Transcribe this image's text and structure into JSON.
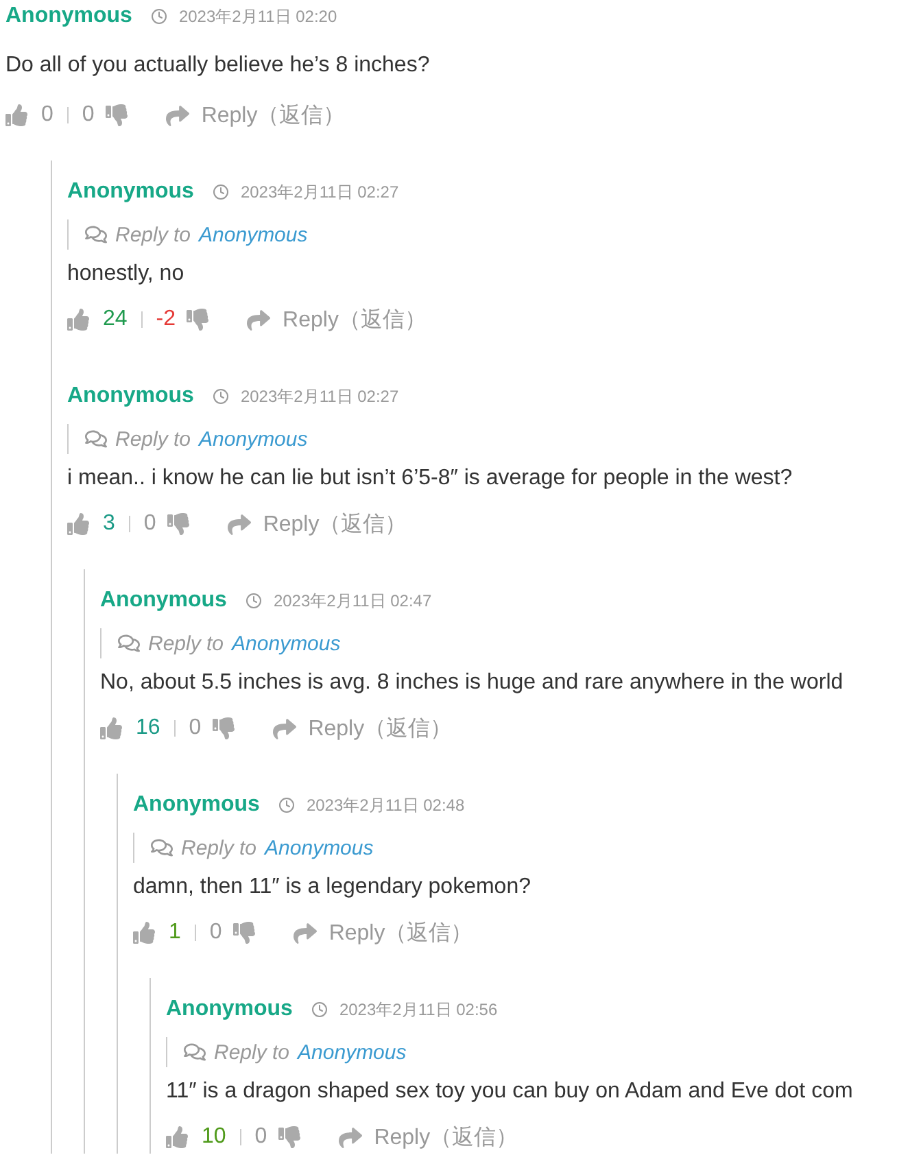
{
  "comments": [
    {
      "author": "Anonymous",
      "date": "2023年2月11日 02:20",
      "body": "Do all of you actually believe he’s 8 inches?",
      "upvotes": {
        "text": "0",
        "color": "#999999"
      },
      "downvotes": {
        "text": "0",
        "color": "#999999"
      },
      "reply": "Reply（返信）",
      "children": [
        {
          "author": "Anonymous",
          "date": "2023年2月11日 02:27",
          "reply_to_label": "Reply to",
          "reply_to": "Anonymous",
          "body": "honestly, no",
          "upvotes": {
            "text": "24",
            "color": "#1f9a4e"
          },
          "downvotes": {
            "text": "-2",
            "color": "#e53935"
          },
          "reply": "Reply（返信）"
        },
        {
          "author": "Anonymous",
          "date": "2023年2月11日 02:27",
          "reply_to_label": "Reply to",
          "reply_to": "Anonymous",
          "body": "i mean.. i know he can lie but isn’t 6’5-8″ is average for people in the west?",
          "upvotes": {
            "text": "3",
            "color": "#1a9a86"
          },
          "downvotes": {
            "text": "0",
            "color": "#999999"
          },
          "reply": "Reply（返信）",
          "children": [
            {
              "author": "Anonymous",
              "date": "2023年2月11日 02:47",
              "reply_to_label": "Reply to",
              "reply_to": "Anonymous",
              "body": "No, about 5.5 inches is avg. 8 inches is huge and rare anywhere in the world",
              "upvotes": {
                "text": "16",
                "color": "#1a9a86"
              },
              "downvotes": {
                "text": "0",
                "color": "#999999"
              },
              "reply": "Reply（返信）",
              "children": [
                {
                  "author": "Anonymous",
                  "date": "2023年2月11日 02:48",
                  "reply_to_label": "Reply to",
                  "reply_to": "Anonymous",
                  "body": "damn, then 11″ is a legendary pokemon?",
                  "upvotes": {
                    "text": "1",
                    "color": "#4f9a1a"
                  },
                  "downvotes": {
                    "text": "0",
                    "color": "#999999"
                  },
                  "reply": "Reply（返信）",
                  "children": [
                    {
                      "author": "Anonymous",
                      "date": "2023年2月11日 02:56",
                      "reply_to_label": "Reply to",
                      "reply_to": "Anonymous",
                      "body": "11″ is a dragon shaped sex toy you can buy on Adam and Eve dot com",
                      "upvotes": {
                        "text": "10",
                        "color": "#4f9a1a"
                      },
                      "downvotes": {
                        "text": "0",
                        "color": "#999999"
                      },
                      "reply": "Reply（返信）"
                    }
                  ]
                }
              ]
            }
          ]
        }
      ]
    }
  ]
}
